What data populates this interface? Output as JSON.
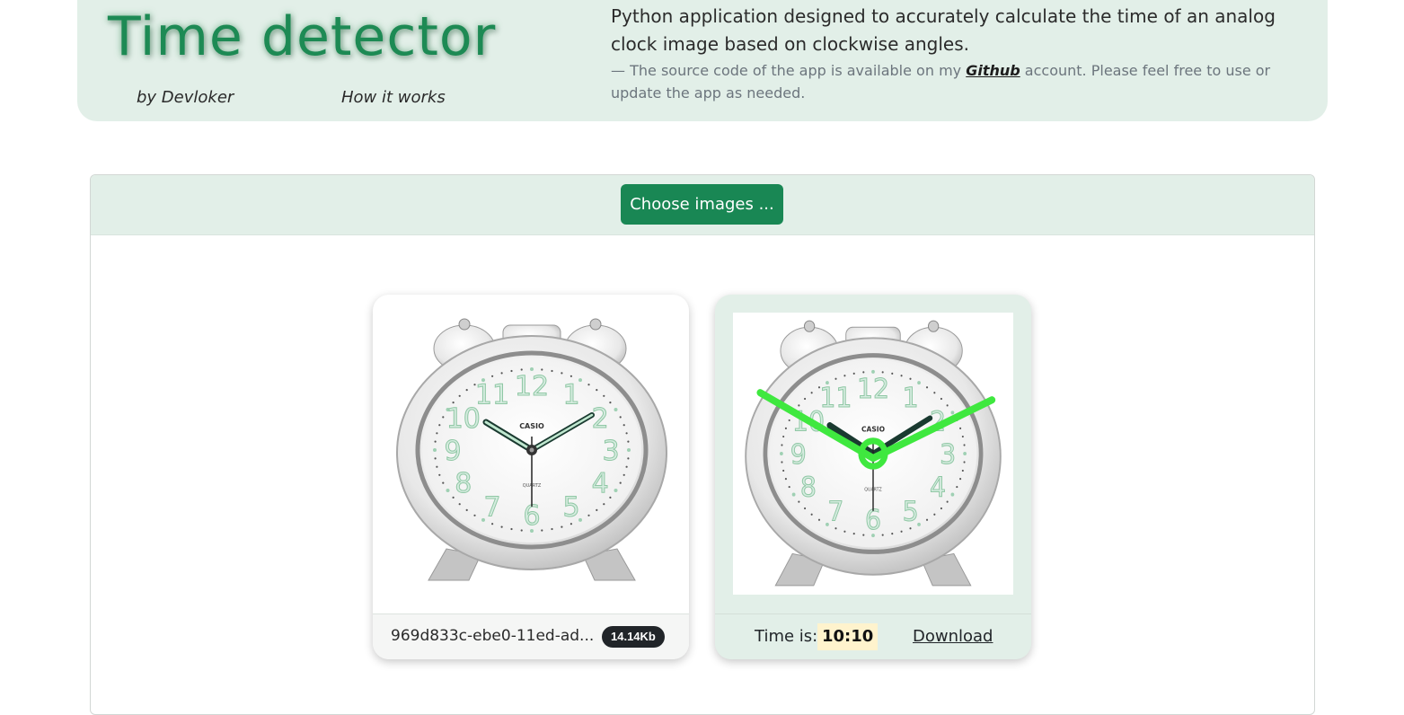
{
  "header": {
    "title": "Time detector",
    "author": "by Devloker",
    "how_link": "How it works",
    "description": "Python application designed to accurately calculate the time of an analog clock image based on clockwise angles.",
    "source_dash": "— ",
    "source_prefix": "The source code of the app is available on my ",
    "github_link": "Github",
    "source_suffix": " account. Please feel free to use or update the app as needed."
  },
  "uploader": {
    "choose_button": "Choose images ..."
  },
  "original": {
    "filename": "969d833c-ebe0-11ed-ad...",
    "size": "14.14Kb",
    "clock_brand": "CASIO",
    "clock_model": "QUARTZ"
  },
  "result": {
    "time_label": "Time is:",
    "time_value": "10:10",
    "download_label": "Download",
    "overlay_color": "#3fe83f"
  },
  "colors": {
    "brand_green": "#198754",
    "header_bg": "#e2efe8",
    "numeral_green": "#8fc7a4"
  }
}
